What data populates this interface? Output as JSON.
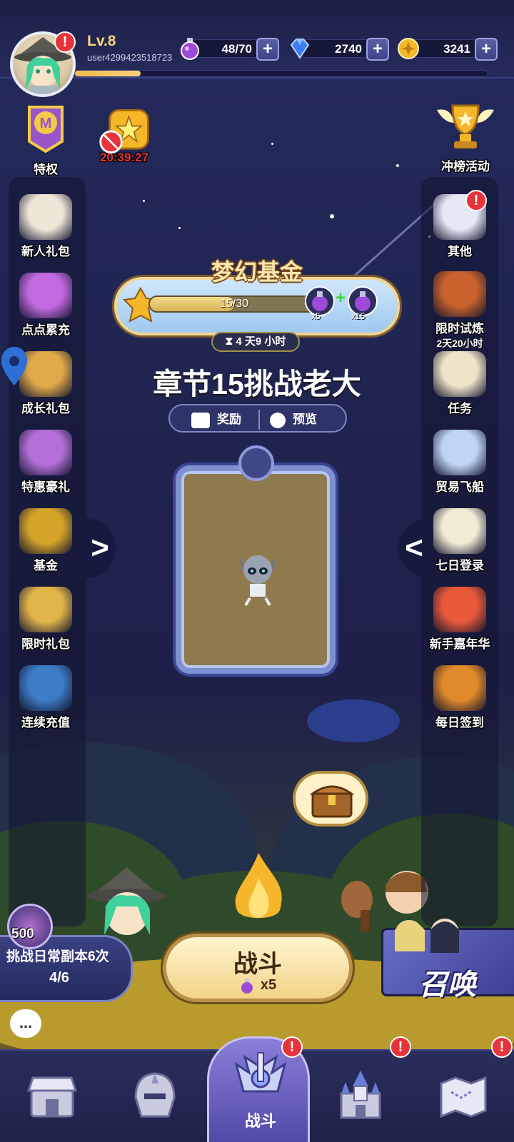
{
  "player": {
    "level": "Lv.8",
    "username": "user4299423518723",
    "xp_fraction": 0.16
  },
  "resources": {
    "stamina": {
      "value": "48/70",
      "icon": "potion-icon"
    },
    "gems": {
      "value": "2740",
      "icon": "diamond-icon"
    },
    "gold": {
      "value": "3241",
      "icon": "coin-icon"
    },
    "plus": "+"
  },
  "top_icons": {
    "privilege_label": "特权",
    "ad_timer": "20:39:27",
    "ranking_label": "冲榜活动"
  },
  "left_menu": [
    {
      "label": "新人礼包",
      "icon": "vampire-girl-icon"
    },
    {
      "label": "点点累充",
      "icon": "gift-box-icon"
    },
    {
      "label": "成长礼包",
      "icon": "card-chest-icon"
    },
    {
      "label": "特惠豪礼",
      "icon": "money-bag-icon"
    },
    {
      "label": "基金",
      "icon": "shield-wings-icon"
    },
    {
      "label": "限时礼包",
      "icon": "gem-chest-icon"
    },
    {
      "label": "连续充值",
      "icon": "treasure-chest-icon"
    }
  ],
  "right_menu": [
    {
      "label": "其他",
      "icon": "menu-icon"
    },
    {
      "label": "限时试炼",
      "sub": "2天20小时",
      "icon": "tv-chest-icon"
    },
    {
      "label": "任务",
      "icon": "scroll-quill-icon"
    },
    {
      "label": "贸易飞船",
      "icon": "airship-icon"
    },
    {
      "label": "七日登录",
      "icon": "calendar-icon"
    },
    {
      "label": "新手嘉年华",
      "icon": "carnival-gift-icon"
    },
    {
      "label": "每日签到",
      "icon": "cards-icon"
    }
  ],
  "fund": {
    "title": "梦幻基金",
    "progress_text": "15/30",
    "progress_fraction": 0.5,
    "reward1_count": "x5",
    "reward2_count": "x15",
    "timer": "4 天9 小时"
  },
  "chapter": {
    "title": "章节15挑战老大",
    "tab_reward": "奖励",
    "tab_preview": "预览"
  },
  "arrows": {
    "left": "<",
    "right": ">"
  },
  "daily": {
    "ticket_count": "500",
    "text": "挑战日常副本6次",
    "progress": "4/6"
  },
  "fight": {
    "label": "战斗",
    "cost": "x5"
  },
  "summon": {
    "label": "召唤"
  },
  "chat": {
    "icon": "..."
  },
  "bottom_nav": [
    {
      "name": "shop",
      "icon": "shop-icon"
    },
    {
      "name": "heroes",
      "icon": "helmet-icon"
    },
    {
      "name": "battle",
      "label": "战斗",
      "icon": "crest-icon"
    },
    {
      "name": "castle",
      "icon": "castle-icon"
    },
    {
      "name": "map",
      "icon": "map-icon"
    }
  ],
  "alert_mark": "!",
  "colors": {
    "background": "#1d2148",
    "accent_gold": "#f3d386",
    "alert_red": "#e7343a"
  }
}
